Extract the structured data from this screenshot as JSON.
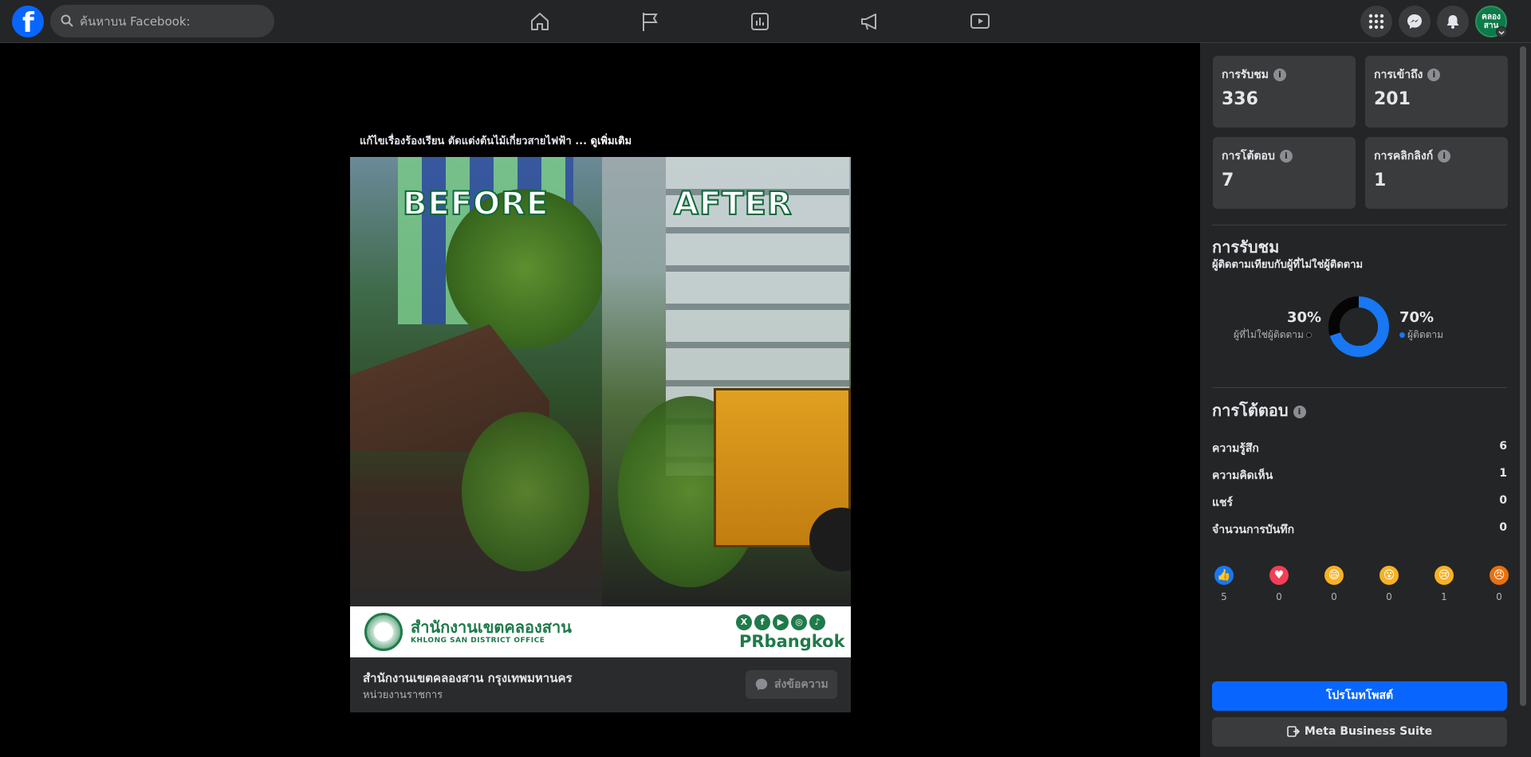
{
  "header": {
    "logo_letter": "f",
    "search_placeholder": "ค้นหาบน Facebook:",
    "avatar_text": "คลอง สาน"
  },
  "post": {
    "caption": "แก้ไขเรื่องร้องเรียน  ตัดแต่งต้นไม้เกี่ยวสายไฟฟ้า ...",
    "see_more": "ดูเพิ่มเติม",
    "image_labels": {
      "before": "BEFORE",
      "after": "AFTER"
    },
    "banner": {
      "title": "สำนักงานเขตคลองสาน",
      "subtitle": "KHLONG SAN DISTRICT OFFICE",
      "brand": "PRbangkok",
      "social": [
        "X",
        "f",
        "▶",
        "◎",
        "♪"
      ]
    },
    "page_name": "สำนักงานเขตคลองสาน กรุงเทพมหานคร",
    "page_type": "หน่วยงานราชการ",
    "message_button": "ส่งข้อความ"
  },
  "insights": {
    "stats": [
      {
        "label": "การรับชม",
        "value": "336"
      },
      {
        "label": "การเข้าถึง",
        "value": "201"
      },
      {
        "label": "การโต้ตอบ",
        "value": "7"
      },
      {
        "label": "การคลิกลิงก์",
        "value": "1"
      }
    ],
    "views": {
      "title": "การรับชม",
      "subtitle": "ผู้ติดตามเทียบกับผู้ที่ไม่ใช่ผู้ติดตาม",
      "non_follower_pct": "30%",
      "non_follower_label": "ผู้ที่ไม่ใช่ผู้ติดตาม",
      "follower_pct": "70%",
      "follower_label": "ผู้ติดตาม",
      "follower_fraction": 0.7,
      "colors": {
        "follower": "#1877f2",
        "non_follower": "#050505"
      }
    },
    "engagement": {
      "title": "การโต้ตอบ",
      "rows": [
        {
          "label": "ความรู้สึก",
          "value": "6"
        },
        {
          "label": "ความคิดเห็น",
          "value": "1"
        },
        {
          "label": "แชร์",
          "value": "0"
        },
        {
          "label": "จำนวนการบันทึก",
          "value": "0"
        }
      ],
      "reactions": [
        {
          "icon": "like-icon",
          "count": "5",
          "color": "#1877f2"
        },
        {
          "icon": "love-icon",
          "count": "0",
          "color": "#f33e58"
        },
        {
          "icon": "haha-icon",
          "count": "0",
          "color": "#f7b125"
        },
        {
          "icon": "wow-icon",
          "count": "0",
          "color": "#f7b125"
        },
        {
          "icon": "sad-icon",
          "count": "1",
          "color": "#f7b125"
        },
        {
          "icon": "angry-icon",
          "count": "0",
          "color": "#e9710f"
        }
      ]
    },
    "promote_button": "โปรโมทโพสต์",
    "mbs_button": "Meta Business Suite"
  }
}
